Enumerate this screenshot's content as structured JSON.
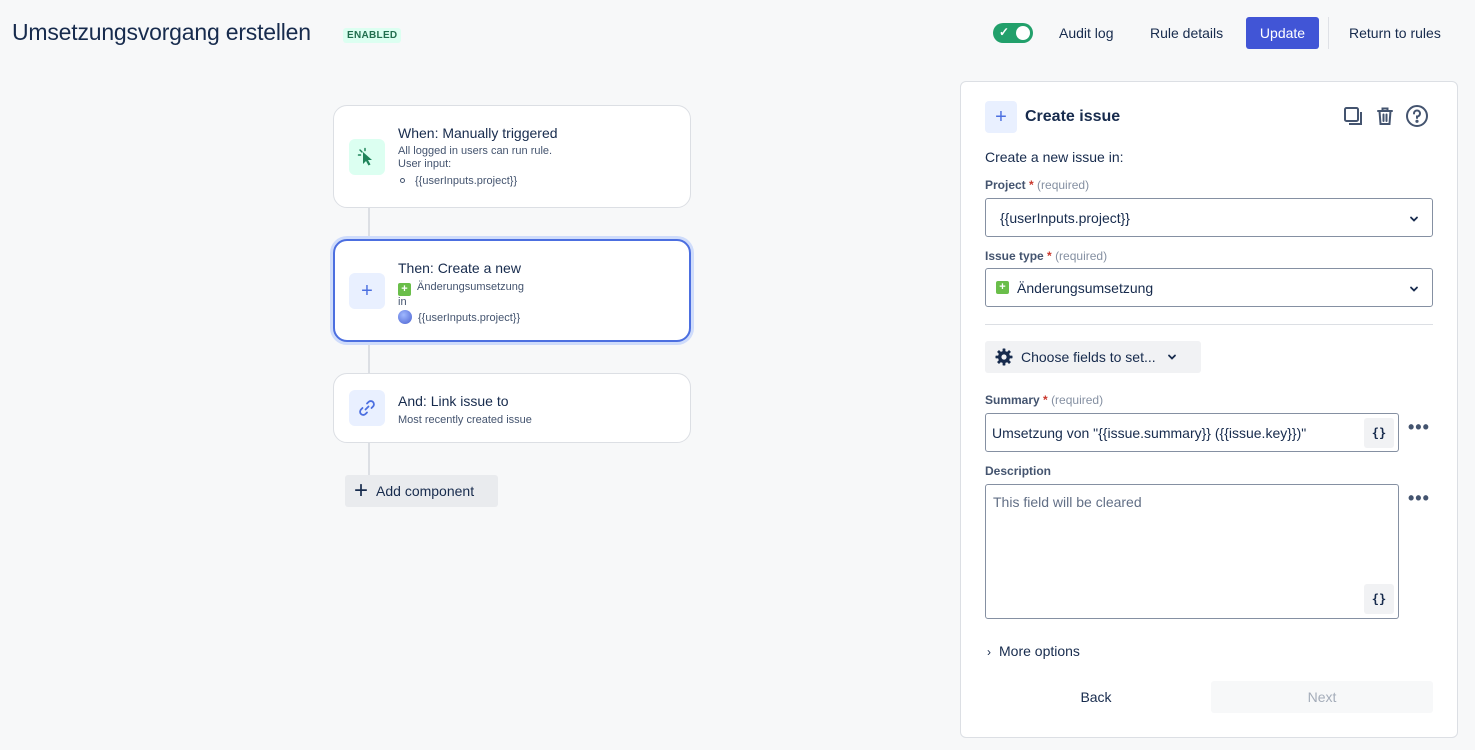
{
  "header": {
    "title": "Umsetzungsvorgang erstellen",
    "status": "ENABLED",
    "toggle_state": "on",
    "audit_log": "Audit log",
    "rule_details": "Rule details",
    "update": "Update",
    "return": "Return to rules"
  },
  "flow": {
    "trigger": {
      "title": "When: Manually triggered",
      "line1": "All logged in users can run rule.",
      "line2": "User input:",
      "bullet": "{{userInputs.project}}"
    },
    "action": {
      "title": "Then: Create a new",
      "issue_type": "Änderungsumsetzung",
      "in": "in",
      "project": "{{userInputs.project}}"
    },
    "link": {
      "title": "And: Link issue to",
      "sub": "Most recently created issue"
    },
    "add_component": "Add component"
  },
  "panel": {
    "title": "Create issue",
    "lead": "Create a new issue in:",
    "project_label": "Project",
    "required_hint": "(required)",
    "project_value": "{{userInputs.project}}",
    "issue_type_label": "Issue type",
    "issue_type_value": "Änderungsumsetzung",
    "choose_fields": "Choose fields to set...",
    "summary_label": "Summary",
    "summary_value": "Umsetzung von \"{{issue.summary}} ({{issue.key}})\"",
    "description_label": "Description",
    "description_placeholder": "This field will be cleared",
    "curly": "{}",
    "more_options": "More options",
    "back": "Back",
    "next": "Next"
  },
  "colors": {
    "primary": "#4155d6",
    "toggle_on": "#22a06b",
    "enabled_text": "#216e4e",
    "selected_border": "#4c6fe0"
  }
}
